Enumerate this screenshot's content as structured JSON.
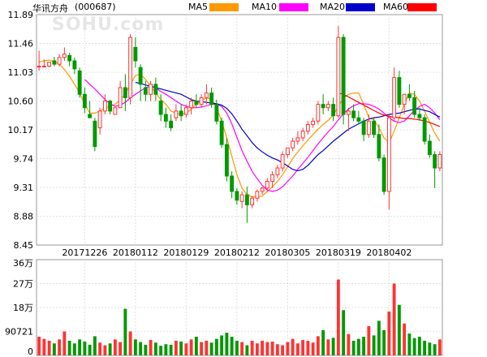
{
  "header": {
    "stock_name": "华讯方舟",
    "stock_code": "(000687)",
    "ma_legend": [
      {
        "label": "MA5",
        "color": "#ff9900"
      },
      {
        "label": "MA10",
        "color": "#ff00ff"
      },
      {
        "label": "MA20",
        "color": "#0000cc"
      },
      {
        "label": "MA60",
        "color": "#ff0000"
      }
    ]
  },
  "watermark": "SOHU.com",
  "chart_data": {
    "type": "candlestick",
    "price_axis": {
      "ticks": [
        "11.89",
        "11.46",
        "11.03",
        "10.60",
        "10.17",
        "9.74",
        "9.31",
        "8.88",
        "8.45"
      ],
      "range": [
        8.45,
        11.89
      ]
    },
    "date_labels": [
      "20171226",
      "20180112",
      "20180129",
      "20180212",
      "20180305",
      "20180319",
      "20180402"
    ],
    "date_label_index": [
      9,
      19,
      29,
      39,
      49,
      59,
      69
    ],
    "volume_axis": {
      "ticks": [
        "36万",
        "27万",
        "18万",
        "90721",
        "0"
      ],
      "tick_values": [
        360000,
        270000,
        180000,
        90721,
        0
      ],
      "range": [
        0,
        360000
      ]
    },
    "up_color": "#ff3333",
    "down_color": "#009900",
    "candles": [
      [
        11.12,
        11.35,
        11.12,
        11.05
      ],
      [
        11.12,
        11.22,
        11.12,
        11.1
      ],
      [
        11.12,
        11.18,
        11.18,
        11.1
      ],
      [
        11.2,
        11.26,
        11.15,
        11.12
      ],
      [
        11.15,
        11.3,
        11.25,
        11.12
      ],
      [
        11.25,
        11.4,
        11.3,
        11.2
      ],
      [
        11.28,
        11.32,
        11.2,
        11.12
      ],
      [
        11.2,
        11.25,
        11.08,
        11.0
      ],
      [
        11.05,
        11.1,
        10.7,
        10.65
      ],
      [
        10.7,
        10.8,
        10.5,
        10.42
      ],
      [
        10.4,
        10.6,
        10.35,
        10.35
      ],
      [
        10.3,
        10.35,
        9.92,
        9.85
      ],
      [
        10.2,
        10.5,
        10.45,
        10.1
      ],
      [
        10.45,
        10.7,
        10.6,
        10.4
      ],
      [
        10.6,
        10.62,
        10.45,
        10.4
      ],
      [
        10.4,
        10.5,
        10.5,
        10.4
      ],
      [
        10.5,
        10.9,
        10.8,
        10.5
      ],
      [
        10.8,
        11.0,
        10.65,
        10.45
      ],
      [
        10.65,
        11.6,
        11.55,
        10.55
      ],
      [
        11.4,
        11.55,
        11.2,
        11.1
      ],
      [
        11.1,
        11.15,
        10.85,
        10.6
      ],
      [
        10.8,
        10.9,
        10.7,
        10.6
      ],
      [
        10.7,
        10.9,
        10.85,
        10.6
      ],
      [
        10.85,
        10.95,
        10.7,
        10.6
      ],
      [
        10.6,
        10.7,
        10.4,
        10.3
      ],
      [
        10.4,
        10.5,
        10.3,
        10.2
      ],
      [
        10.3,
        10.4,
        10.2,
        10.15
      ],
      [
        10.35,
        10.55,
        10.45,
        10.3
      ],
      [
        10.45,
        10.55,
        10.38,
        10.3
      ],
      [
        10.4,
        10.55,
        10.5,
        10.35
      ],
      [
        10.5,
        10.65,
        10.6,
        10.4
      ],
      [
        10.6,
        10.7,
        10.55,
        10.5
      ],
      [
        10.55,
        10.7,
        10.65,
        10.5
      ],
      [
        10.65,
        10.85,
        10.72,
        10.55
      ],
      [
        10.72,
        10.8,
        10.55,
        10.5
      ],
      [
        10.55,
        10.62,
        10.3,
        10.25
      ],
      [
        10.3,
        10.35,
        9.95,
        9.9
      ],
      [
        9.95,
        10.05,
        9.48,
        9.4
      ],
      [
        9.48,
        9.55,
        9.25,
        9.15
      ],
      [
        9.25,
        9.3,
        9.12,
        9.05
      ],
      [
        9.1,
        9.25,
        9.2,
        9.0
      ],
      [
        9.2,
        9.32,
        9.05,
        8.78
      ],
      [
        9.05,
        9.18,
        9.15,
        9.0
      ],
      [
        9.15,
        9.28,
        9.25,
        9.1
      ],
      [
        9.25,
        9.32,
        9.3,
        9.2
      ],
      [
        9.3,
        9.45,
        9.4,
        9.25
      ],
      [
        9.4,
        9.55,
        9.5,
        9.3
      ],
      [
        9.5,
        9.65,
        9.6,
        9.45
      ],
      [
        9.6,
        9.85,
        9.8,
        9.55
      ],
      [
        9.8,
        9.9,
        9.9,
        9.75
      ],
      [
        9.9,
        10.05,
        10.0,
        9.85
      ],
      [
        10.0,
        10.15,
        10.05,
        9.95
      ],
      [
        10.05,
        10.2,
        10.15,
        10.0
      ],
      [
        10.15,
        10.3,
        10.25,
        10.1
      ],
      [
        10.25,
        10.35,
        10.3,
        10.2
      ],
      [
        10.3,
        10.6,
        10.55,
        10.25
      ],
      [
        10.55,
        10.7,
        10.5,
        10.4
      ],
      [
        10.5,
        10.6,
        10.55,
        10.45
      ],
      [
        10.55,
        10.65,
        10.38,
        10.3
      ],
      [
        10.38,
        11.72,
        11.55,
        10.35
      ],
      [
        11.55,
        11.6,
        10.4,
        10.25
      ],
      [
        10.4,
        10.5,
        10.45,
        10.15
      ],
      [
        10.45,
        10.55,
        10.35,
        10.3
      ],
      [
        10.35,
        10.45,
        10.3,
        10.25
      ],
      [
        10.3,
        10.35,
        10.1,
        10.0
      ],
      [
        10.1,
        10.4,
        10.3,
        10.05
      ],
      [
        10.3,
        10.35,
        10.1,
        10.05
      ],
      [
        10.1,
        10.25,
        9.75,
        9.7
      ],
      [
        9.75,
        9.8,
        9.25,
        9.2
      ],
      [
        9.25,
        10.4,
        10.35,
        8.98
      ],
      [
        10.35,
        11.1,
        10.95,
        10.3
      ],
      [
        10.95,
        11.05,
        10.55,
        10.5
      ],
      [
        10.55,
        10.7,
        10.7,
        10.4
      ],
      [
        10.7,
        10.85,
        10.65,
        10.6
      ],
      [
        10.65,
        10.75,
        10.4,
        10.35
      ],
      [
        10.4,
        10.5,
        10.35,
        10.3
      ],
      [
        10.35,
        10.4,
        10.0,
        9.95
      ],
      [
        10.0,
        10.1,
        9.8,
        9.75
      ],
      [
        9.8,
        9.85,
        9.6,
        9.3
      ],
      [
        9.6,
        9.85,
        9.8,
        9.55
      ]
    ],
    "volumes": [
      70000,
      62000,
      55000,
      45000,
      60000,
      90000,
      55000,
      45000,
      60000,
      52000,
      40000,
      72000,
      48000,
      38000,
      45000,
      60000,
      50000,
      175000,
      90000,
      60000,
      50000,
      40000,
      58000,
      48000,
      36000,
      42000,
      40000,
      55000,
      52000,
      45000,
      60000,
      70000,
      50000,
      55000,
      48000,
      62000,
      75000,
      85000,
      70000,
      55000,
      50000,
      38000,
      55000,
      45000,
      55000,
      50000,
      52000,
      42000,
      38000,
      50000,
      62000,
      45000,
      58000,
      55000,
      48000,
      72000,
      95000,
      60000,
      66000,
      285000,
      170000,
      80000,
      55000,
      62000,
      70000,
      110000,
      75000,
      130000,
      95000,
      165000,
      270000,
      190000,
      120000,
      82000,
      65000,
      70000,
      55000,
      48000,
      42000,
      60000
    ],
    "ma": {
      "MA5": [
        11.18,
        11.2,
        11.21,
        11.19,
        11.15,
        11.07,
        10.97,
        10.85,
        10.72,
        10.55,
        10.42,
        10.42,
        10.45,
        10.5,
        10.52,
        10.55,
        10.62,
        10.7,
        10.85,
        10.98,
        11.0,
        10.92,
        10.82,
        10.72,
        10.62,
        10.55,
        10.45,
        10.42,
        10.4,
        10.42,
        10.48,
        10.55,
        10.6,
        10.65,
        10.62,
        10.5,
        10.3,
        10.05,
        9.78,
        9.5,
        9.3,
        9.2,
        9.17,
        9.17,
        9.18,
        9.25,
        9.32,
        9.4,
        9.5,
        9.62,
        9.74,
        9.84,
        9.93,
        10.02,
        10.1,
        10.18,
        10.25,
        10.31,
        10.39,
        10.52,
        10.64,
        10.7,
        10.72,
        10.72,
        10.55,
        10.35,
        10.32,
        10.2,
        10.05,
        9.98,
        10.15,
        10.35,
        10.55,
        10.72,
        10.7,
        10.6,
        10.45,
        10.28,
        10.12,
        10.0
      ],
      "MA10": [
        null,
        null,
        null,
        null,
        null,
        null,
        null,
        null,
        null,
        10.92,
        10.85,
        10.78,
        10.7,
        10.62,
        10.56,
        10.52,
        10.54,
        10.58,
        10.65,
        10.7,
        10.75,
        10.8,
        10.82,
        10.8,
        10.74,
        10.7,
        10.65,
        10.6,
        10.55,
        10.52,
        10.5,
        10.5,
        10.51,
        10.53,
        10.55,
        10.55,
        10.52,
        10.42,
        10.26,
        10.06,
        9.86,
        9.7,
        9.55,
        9.44,
        9.34,
        9.27,
        9.25,
        9.27,
        9.32,
        9.4,
        9.48,
        9.58,
        9.67,
        9.76,
        9.86,
        9.96,
        10.05,
        10.14,
        10.22,
        10.32,
        10.41,
        10.48,
        10.53,
        10.56,
        10.56,
        10.55,
        10.52,
        10.48,
        10.42,
        10.35,
        10.3,
        10.28,
        10.3,
        10.38,
        10.46,
        10.52,
        10.55,
        10.5,
        10.42,
        10.32
      ],
      "MA20": [
        null,
        null,
        null,
        null,
        null,
        null,
        null,
        null,
        null,
        null,
        null,
        null,
        null,
        null,
        null,
        null,
        null,
        null,
        null,
        10.88,
        10.86,
        10.84,
        10.82,
        10.8,
        10.78,
        10.76,
        10.74,
        10.72,
        10.7,
        10.66,
        10.62,
        10.6,
        10.59,
        10.58,
        10.57,
        10.56,
        10.54,
        10.49,
        10.41,
        10.3,
        10.18,
        10.08,
        9.98,
        9.9,
        9.84,
        9.79,
        9.75,
        9.72,
        9.68,
        9.63,
        9.58,
        9.56,
        9.58,
        9.64,
        9.72,
        9.8,
        9.86,
        9.93,
        10.0,
        10.06,
        10.12,
        10.18,
        10.22,
        10.26,
        10.3,
        10.33,
        10.35,
        10.36,
        10.38,
        10.4,
        10.41,
        10.42,
        10.44,
        10.46,
        10.48,
        10.48,
        10.46,
        10.44,
        10.4,
        10.36
      ],
      "MA60": [
        null,
        null,
        null,
        null,
        null,
        null,
        null,
        null,
        null,
        null,
        null,
        null,
        null,
        null,
        null,
        null,
        null,
        null,
        null,
        null,
        null,
        null,
        null,
        null,
        null,
        null,
        null,
        null,
        null,
        null,
        null,
        null,
        null,
        null,
        null,
        null,
        null,
        null,
        null,
        null,
        null,
        null,
        null,
        null,
        null,
        null,
        null,
        null,
        null,
        null,
        null,
        null,
        null,
        null,
        null,
        null,
        null,
        null,
        null,
        10.72,
        10.7,
        10.66,
        10.62,
        10.58,
        10.54,
        10.5,
        10.46,
        10.42,
        10.39,
        10.37,
        10.36,
        10.35,
        10.34,
        10.34,
        10.33,
        10.32,
        10.3,
        10.28,
        10.25,
        10.22
      ]
    }
  }
}
